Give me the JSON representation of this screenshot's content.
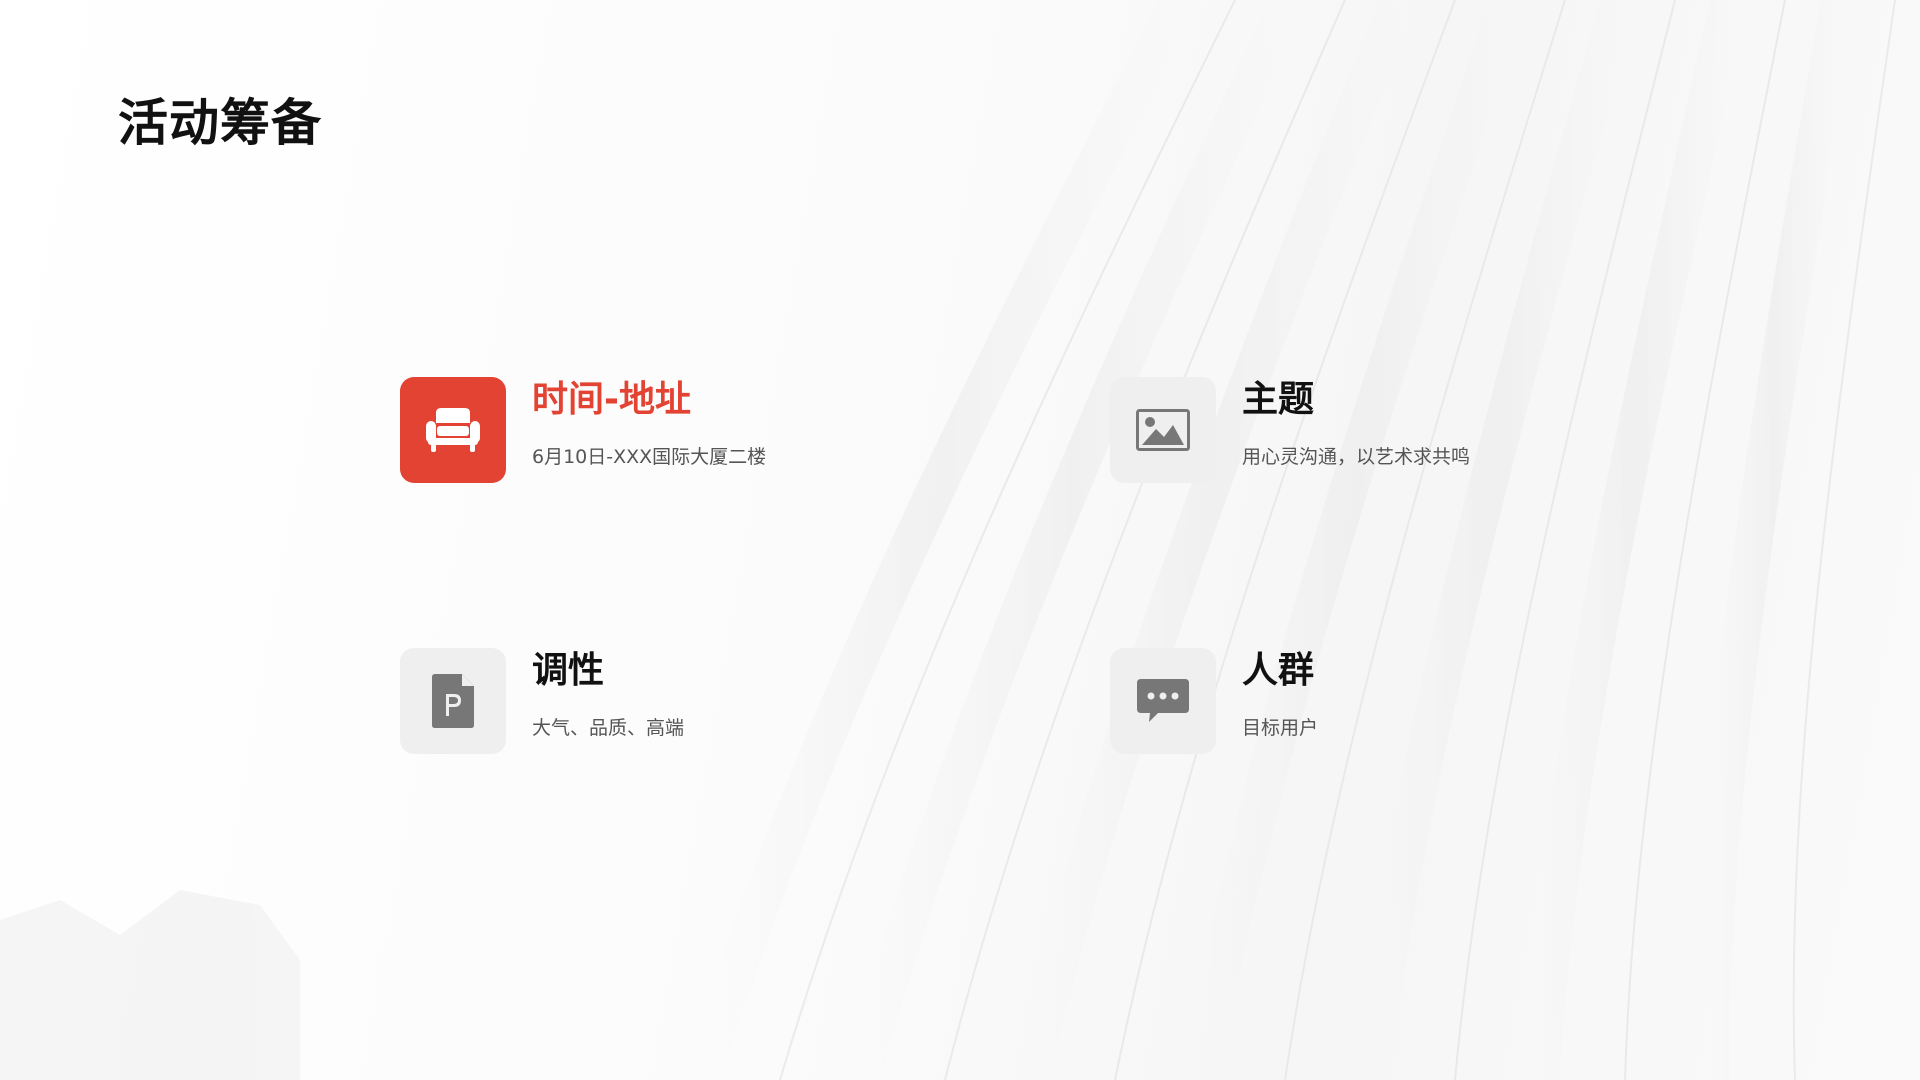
{
  "slide": {
    "title": "活动筹备",
    "accent_color": "#e34333",
    "items": [
      {
        "title": "时间-地址",
        "desc": "6月10日-XXX国际大厦二楼",
        "icon": "sofa-icon",
        "style": "accent"
      },
      {
        "title": "主题",
        "desc": "用心灵沟通，以艺术求共鸣",
        "icon": "image-icon",
        "style": "neutral"
      },
      {
        "title": "调性",
        "desc": "大气、品质、高端",
        "icon": "ppt-file-icon",
        "style": "neutral"
      },
      {
        "title": "人群",
        "desc": "目标用户",
        "icon": "chat-bubble-icon",
        "style": "neutral"
      }
    ]
  }
}
